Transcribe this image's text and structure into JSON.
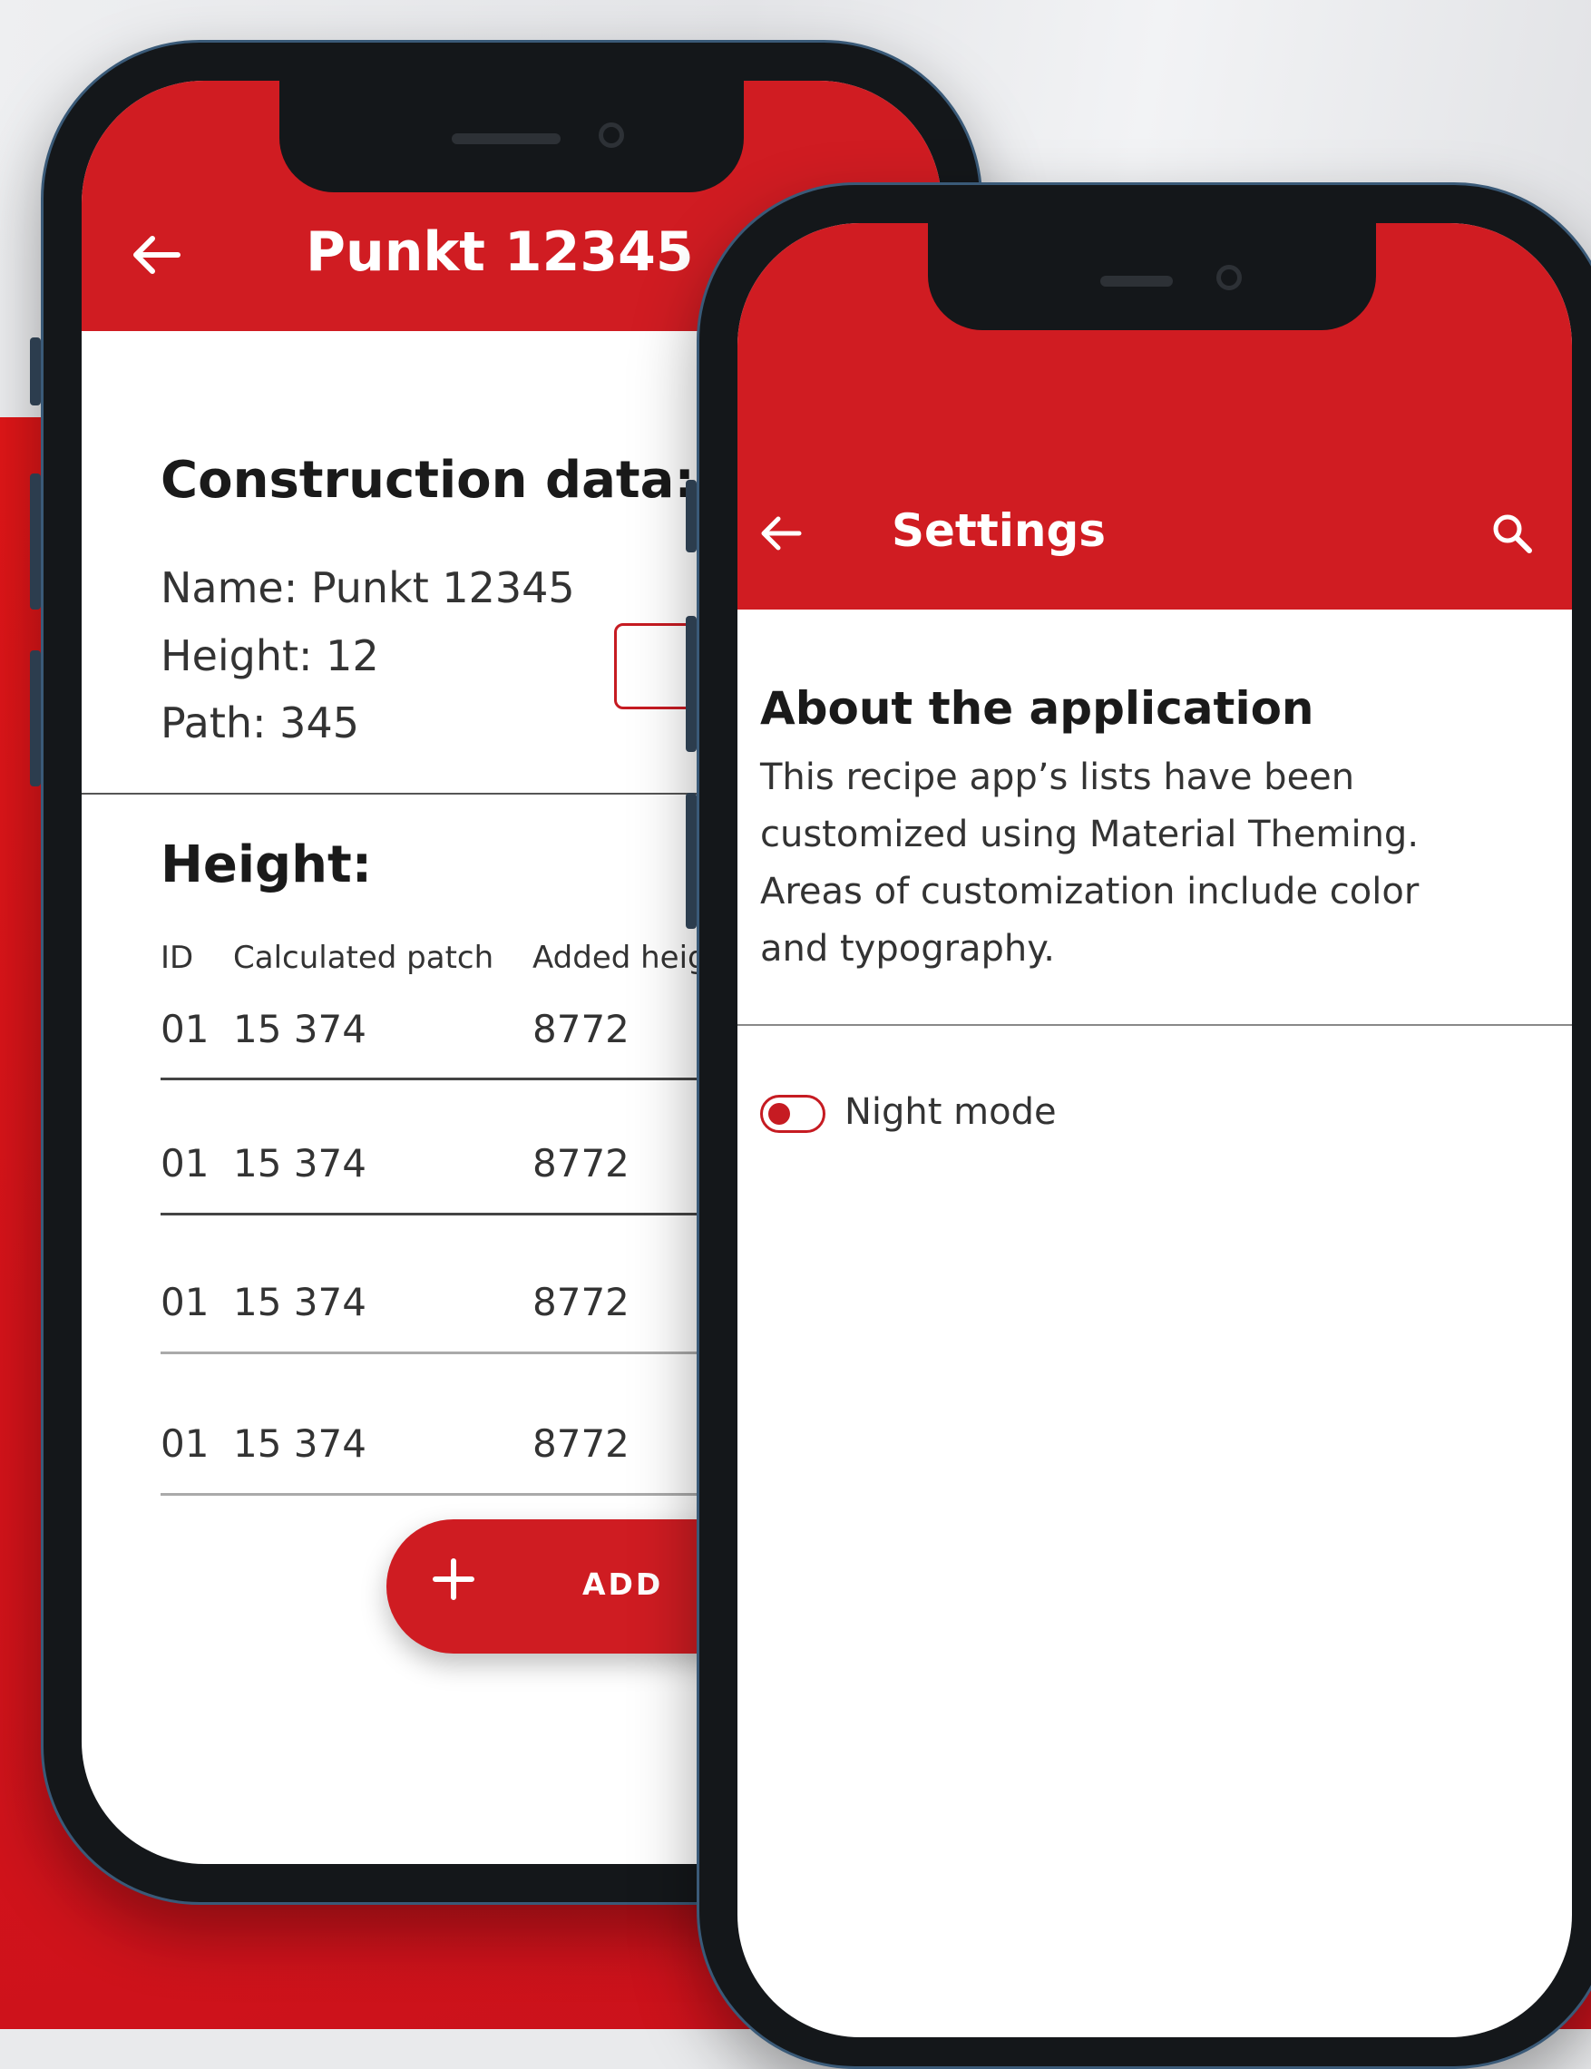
{
  "colors": {
    "primary_red": "#d01c22",
    "frame_dark": "#14171a",
    "frame_edge": "#3a5a78",
    "background_red": "#dc1519"
  },
  "phone1": {
    "appbar": {
      "back_icon": "arrow-left-icon",
      "title": "Punkt 12345"
    },
    "construction": {
      "heading": "Construction data:",
      "name": "Name: Punkt 12345",
      "height": "Height: 12",
      "path": "Path: 345"
    },
    "height_section": {
      "heading": "Height:",
      "columns": [
        "ID",
        "Calculated patch",
        "Added height"
      ],
      "rows": [
        {
          "id": "01",
          "calculated": "15 374",
          "added": "8772"
        },
        {
          "id": "01",
          "calculated": "15 374",
          "added": "8772"
        },
        {
          "id": "01",
          "calculated": "15 374",
          "added": "8772"
        },
        {
          "id": "01",
          "calculated": "15 374",
          "added": "8772"
        }
      ]
    },
    "fab": {
      "icon": "plus-icon",
      "label": "ADD"
    }
  },
  "phone2": {
    "appbar": {
      "back_icon": "arrow-left-icon",
      "title": "Settings",
      "search_icon": "search-icon"
    },
    "about": {
      "heading": "About the application",
      "lines": [
        "This recipe app’s lists have been",
        "customized using Material Theming.",
        "Areas of customization include color",
        "and typography."
      ]
    },
    "night_mode": {
      "label": "Night mode",
      "enabled": false
    }
  }
}
